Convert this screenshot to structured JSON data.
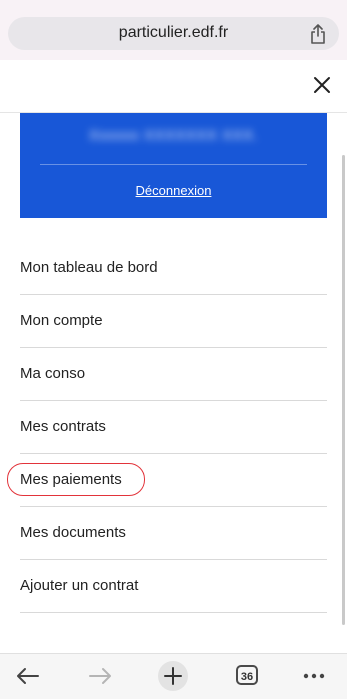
{
  "browser": {
    "url": "particulier.edf.fr",
    "tabs_count": "36"
  },
  "menu": {
    "user_name": "Xxxxxx XXXXXXX XXX.",
    "logout_label": "Déconnexion",
    "card_color": "#1857d7",
    "items": [
      {
        "label": "Mon tableau de bord"
      },
      {
        "label": "Mon compte"
      },
      {
        "label": "Ma conso"
      },
      {
        "label": "Mes contrats"
      },
      {
        "label": "Mes paiements",
        "highlighted": true
      },
      {
        "label": "Mes documents"
      },
      {
        "label": "Ajouter un contrat"
      }
    ]
  },
  "icons": {
    "share": "share-icon",
    "close": "close-icon",
    "back": "back-arrow-icon",
    "forward": "forward-arrow-icon",
    "new_tab": "plus-icon",
    "more": "more-dots-icon"
  }
}
